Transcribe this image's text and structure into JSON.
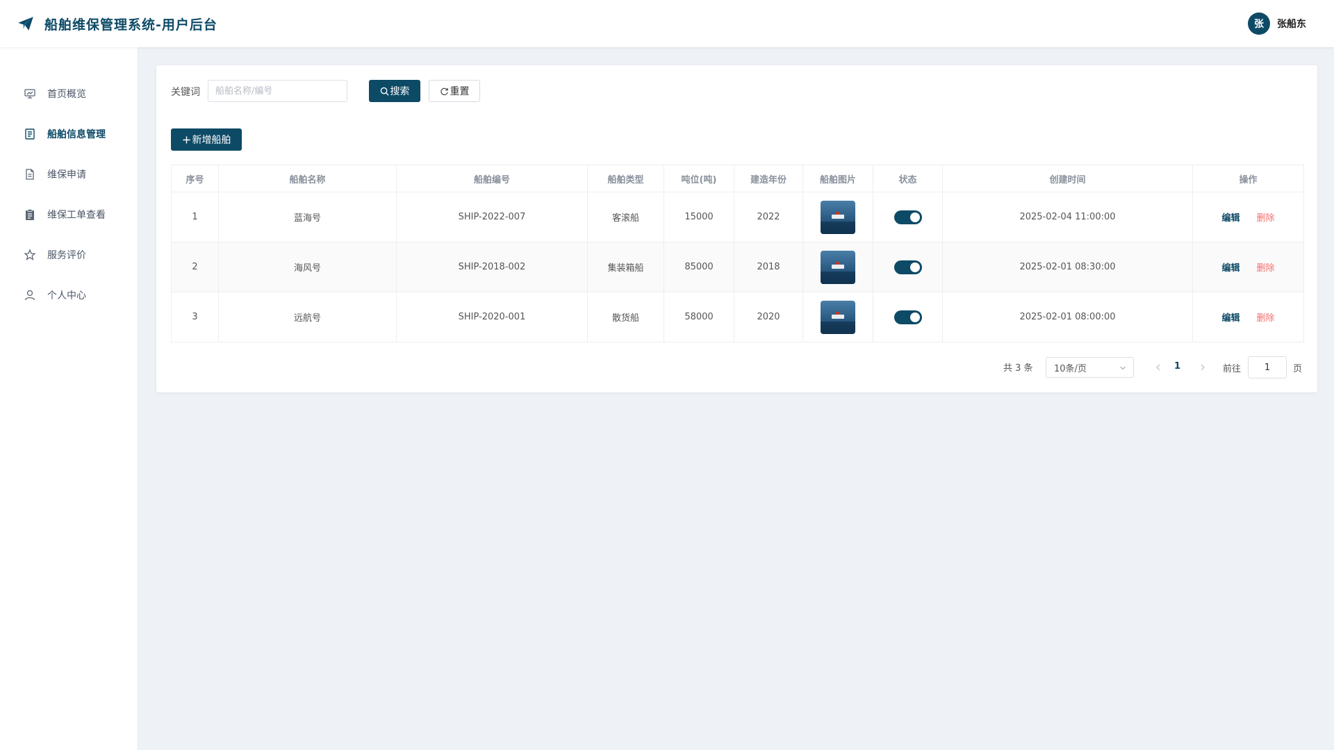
{
  "header": {
    "title": "船舶维保管理系统-用户后台",
    "logo_icon": "paper-plane-icon",
    "user": {
      "avatar_text": "张",
      "name": "张船东"
    }
  },
  "sidebar": {
    "items": [
      {
        "label": "首页概览",
        "icon": "presentation-icon",
        "active": false
      },
      {
        "label": "船舶信息管理",
        "icon": "document-icon",
        "active": true
      },
      {
        "label": "维保申请",
        "icon": "file-icon",
        "active": false
      },
      {
        "label": "维保工单查看",
        "icon": "clipboard-icon",
        "active": false
      },
      {
        "label": "服务评价",
        "icon": "star-icon",
        "active": false
      },
      {
        "label": "个人中心",
        "icon": "user-icon",
        "active": false
      }
    ]
  },
  "search": {
    "keyword_label": "关键词",
    "placeholder": "船舶名称/编号",
    "value": "",
    "search_label": "搜索",
    "reset_label": "重置",
    "add_label": "新增船舶"
  },
  "table": {
    "columns": [
      "序号",
      "船舶名称",
      "船舶编号",
      "船舶类型",
      "吨位(吨)",
      "建造年份",
      "船舶图片",
      "状态",
      "创建时间",
      "操作"
    ],
    "rows": [
      {
        "index": "1",
        "name": "蓝海号",
        "code": "SHIP-2022-007",
        "type": "客滚船",
        "tonnage": "15000",
        "year": "2022",
        "status_on": true,
        "created": "2025-02-04 11:00:00"
      },
      {
        "index": "2",
        "name": "海风号",
        "code": "SHIP-2018-002",
        "type": "集装箱船",
        "tonnage": "85000",
        "year": "2018",
        "status_on": true,
        "created": "2025-02-01 08:30:00"
      },
      {
        "index": "3",
        "name": "远航号",
        "code": "SHIP-2020-001",
        "type": "散货船",
        "tonnage": "58000",
        "year": "2020",
        "status_on": true,
        "created": "2025-02-01 08:00:00"
      }
    ],
    "edit_label": "编辑",
    "delete_label": "删除"
  },
  "pagination": {
    "total_text": "共 3 条",
    "page_size": "10条/页",
    "current_page": "1",
    "goto_label": "前往",
    "goto_value": "1",
    "page_suffix": "页"
  },
  "colors": {
    "primary": "#0d4a66",
    "danger": "#f56c6c",
    "background": "#eef2f6"
  }
}
